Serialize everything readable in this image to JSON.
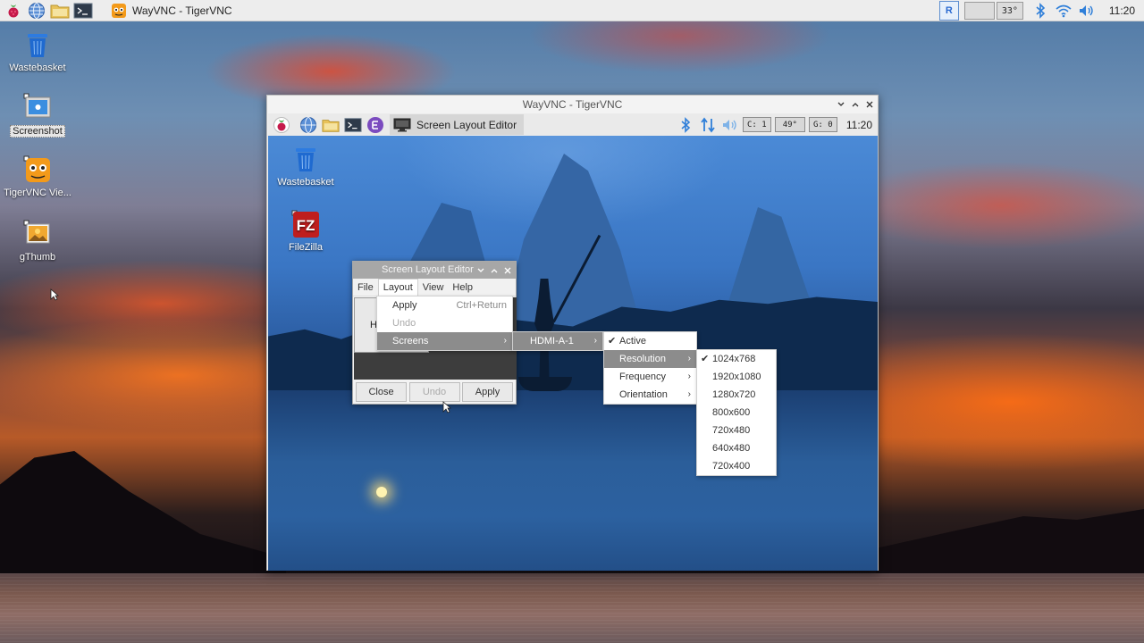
{
  "taskbar": {
    "task_title": "WayVNC - TigerVNC",
    "temp": "33°",
    "clock": "11:20",
    "icons": [
      "raspberry-menu-icon",
      "web-browser-icon",
      "file-manager-icon",
      "terminal-icon"
    ]
  },
  "desktop": {
    "icons": [
      {
        "label": "Wastebasket",
        "icon": "wastebasket-icon"
      },
      {
        "label": "Screenshot",
        "icon": "screenshot-icon",
        "selected": true
      },
      {
        "label": "TigerVNC Vie...",
        "icon": "tigervnc-icon"
      },
      {
        "label": "gThumb",
        "icon": "gthumb-icon"
      }
    ]
  },
  "vnc_window": {
    "title": "WayVNC - TigerVNC",
    "panel": {
      "task_title": "Screen Layout Editor",
      "cpu": "C: 1",
      "temp": "49°",
      "gpu": "G: 0",
      "clock": "11:20"
    },
    "remote_desktop": {
      "icons": [
        {
          "label": "Wastebasket",
          "icon": "wastebasket-icon"
        },
        {
          "label": "FileZilla",
          "icon": "filezilla-icon"
        }
      ]
    }
  },
  "screen_layout_editor": {
    "title": "Screen Layout Editor",
    "menus": [
      "File",
      "Layout",
      "View",
      "Help"
    ],
    "screen_label": "H",
    "buttons": {
      "close": "Close",
      "undo": "Undo",
      "apply": "Apply"
    }
  },
  "layout_menu": {
    "items": [
      {
        "label": "Apply",
        "shortcut": "Ctrl+Return"
      },
      {
        "label": "Undo",
        "disabled": true
      },
      {
        "label": "Screens",
        "submenu": true
      }
    ]
  },
  "screens_menu": {
    "items": [
      {
        "label": "HDMI-A-1",
        "submenu": true
      }
    ]
  },
  "output_menu": {
    "items": [
      {
        "label": "Active",
        "checked": true
      },
      {
        "label": "Resolution",
        "submenu": true
      },
      {
        "label": "Frequency",
        "submenu": true
      },
      {
        "label": "Orientation",
        "submenu": true
      }
    ]
  },
  "resolution_menu": {
    "items": [
      "1024x768",
      "1920x1080",
      "1280x720",
      "800x600",
      "720x480",
      "640x480",
      "720x400"
    ],
    "selected": "1024x768"
  },
  "colors": {
    "taskbar": "#ededed",
    "menu_highlight": "#8c8c8c",
    "dialog_title": "#a7a7a7",
    "bluetooth": "#2f7fd9"
  }
}
